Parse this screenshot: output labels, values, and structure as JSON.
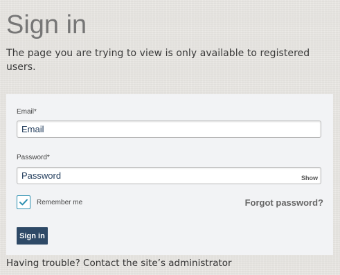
{
  "page": {
    "title": "Sign in",
    "subtitle": "The page you are trying to view is only available to registered users."
  },
  "form": {
    "email": {
      "label": "Email*",
      "placeholder": "Email",
      "value": ""
    },
    "password": {
      "label": "Password*",
      "placeholder": "Password",
      "value": "",
      "show_toggle": "Show"
    },
    "remember": {
      "label": "Remember me",
      "checked": true
    },
    "forgot_link": "Forgot password?",
    "submit_label": "Sign in"
  },
  "footer": {
    "help_text": "Having trouble? Contact the site’s administrator"
  },
  "colors": {
    "accent": "#2a8fb0",
    "button": "#2e4966"
  },
  "icons": {
    "checkbox": "check-icon"
  }
}
